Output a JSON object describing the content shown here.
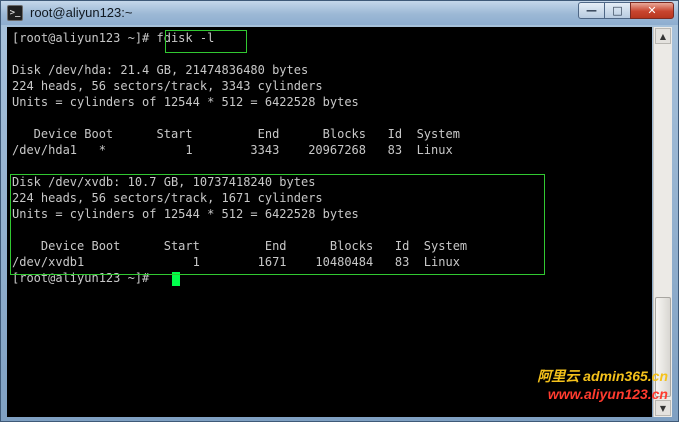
{
  "window": {
    "title": "root@aliyun123:~",
    "icon": "putty-terminal-icon",
    "buttons": {
      "minimize": "—",
      "maximize": "□",
      "close": "✕"
    }
  },
  "terminal": {
    "lines": [
      "[root@aliyun123 ~]# fdisk -l",
      "",
      "Disk /dev/hda: 21.4 GB, 21474836480 bytes",
      "224 heads, 56 sectors/track, 3343 cylinders",
      "Units = cylinders of 12544 * 512 = 6422528 bytes",
      "",
      "   Device Boot      Start         End      Blocks   Id  System",
      "/dev/hda1   *           1        3343    20967268   83  Linux",
      "",
      "Disk /dev/xvdb: 10.7 GB, 10737418240 bytes",
      "224 heads, 56 sectors/track, 1671 cylinders",
      "Units = cylinders of 12544 * 512 = 6422528 bytes",
      "",
      "    Device Boot      Start         End      Blocks   Id  System",
      "/dev/xvdb1               1        1671    10480484   83  Linux",
      "[root@aliyun123 ~]#"
    ],
    "cursor_color": "#00ff4c",
    "text_color": "#c8c8c8",
    "highlight_color": "#31c831"
  },
  "scrollbar": {
    "up_arrow": "▲",
    "down_arrow": "▼"
  },
  "watermark": {
    "line1": "阿里云 admin365.cn",
    "line2": "www.aliyun123.cn"
  }
}
